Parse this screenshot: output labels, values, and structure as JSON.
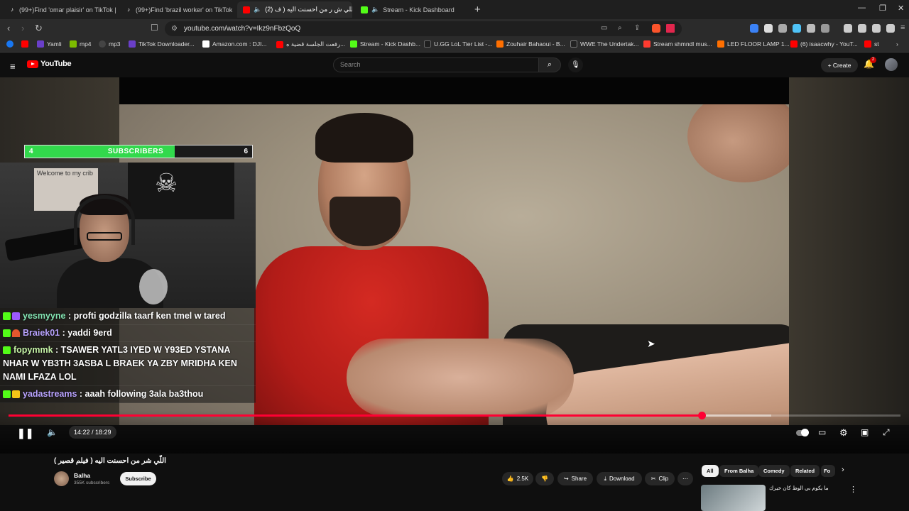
{
  "browser": {
    "tabs": [
      {
        "label": "(99+)Find 'omar plaisir' on TikTok | Ti",
        "icon": "tiktok-icon",
        "color": "#1f1f1f"
      },
      {
        "label": "(99+)Find 'brazil worker' on TikTok | Ti",
        "icon": "tiktok-icon",
        "color": "#1f1f1f"
      },
      {
        "label": "(2) اللي ش ر من احسنت اليه ( ف",
        "icon": "youtube-icon",
        "color": "#ff0000",
        "active": true
      },
      {
        "label": "Stream - Kick Dashboard",
        "icon": "kick-icon",
        "color": "#53fc18"
      }
    ],
    "url": "youtube.com/watch?v=Ikz9nFbzQoQ",
    "bookmarks": [
      {
        "label": "",
        "color": "#1877f2"
      },
      {
        "label": "",
        "color": "#ff0000"
      },
      {
        "label": "Yamli",
        "color": "#6a3fc9"
      },
      {
        "label": "mp4",
        "color": "#7cbb00"
      },
      {
        "label": "mp3",
        "color": "#333333"
      },
      {
        "label": "TikTok Downloader...",
        "color": "#6a3fc9"
      },
      {
        "label": "Amazon.com : DJI...",
        "color": "#ffffff"
      },
      {
        "label": "رفعت الجلسة قضية ه...",
        "color": "#ff0000"
      },
      {
        "label": "Stream - Kick Dashb...",
        "color": "#53fc18"
      },
      {
        "label": "U.GG LoL Tier List -...",
        "color": "#1f1f1f"
      },
      {
        "label": "Zouhair Bahaoui - B...",
        "color": "#ff6f00"
      },
      {
        "label": "WWE The Undertak...",
        "color": "#222222"
      },
      {
        "label": "Stream shmndl mus...",
        "color": "#ff3b30"
      },
      {
        "label": "LED FLOOR LAMP 1...",
        "color": "#ff6f00"
      },
      {
        "label": "(6) isaacwhy - YouT...",
        "color": "#ff0000"
      },
      {
        "label": "st",
        "color": "#ff0000"
      }
    ]
  },
  "youtube": {
    "logo_text": "YouTube",
    "search_placeholder": "Search",
    "create_label": "Create",
    "notification_count": "2"
  },
  "overlay": {
    "sub_goal_left": "4",
    "sub_goal_label": "SUBSCRIBERS",
    "sub_goal_right": "6",
    "sub_goal_progress": 0.66,
    "poster_text": "Welcome to my crib",
    "chat": [
      {
        "user": "yesmyyne",
        "user_color": "#84e5b3",
        "text": " : profti godzilla taarf ken tmel w tared",
        "badges": [
          "#53fc18",
          "#9b59ff"
        ]
      },
      {
        "user": "Braiek01",
        "user_color": "#b9a3ff",
        "text": " : yaddi 9erd",
        "badges": [
          "#53fc18",
          "#e4572e"
        ]
      },
      {
        "user": "fopymmk",
        "user_color": "#c7f5a8",
        "text": " : TSAWER YATL3 IYED W Y93ED YSTANA NHAR W YB3TH 3ASBA L BRAEK YA ZBY MRIDHA KEN NAMI LFAZA LOL",
        "badges": [
          "#53fc18"
        ]
      },
      {
        "user": "yadastreams",
        "user_color": "#b9a3ff",
        "text": " : aaah following 3ala ba3thou",
        "badges": [
          "#53fc18",
          "#f5c518"
        ]
      }
    ]
  },
  "player": {
    "time": "14:22 / 18:29",
    "progress": 0.777,
    "buffered": 0.855
  },
  "video_info": {
    "title": "اللّي شر من احسنت اليه ( فيلم قصير )",
    "channel": "Balha",
    "subscribers": "355K subscribers",
    "subscribe_label": "Subscribe",
    "likes": "2.5K",
    "share_label": "Share",
    "download_label": "Download",
    "clip_label": "Clip"
  },
  "related": {
    "chips": [
      "All",
      "From Balha",
      "Comedy",
      "Related",
      "Fo"
    ],
    "first_title": "ما يكوم بي الوط كان خيرك"
  }
}
